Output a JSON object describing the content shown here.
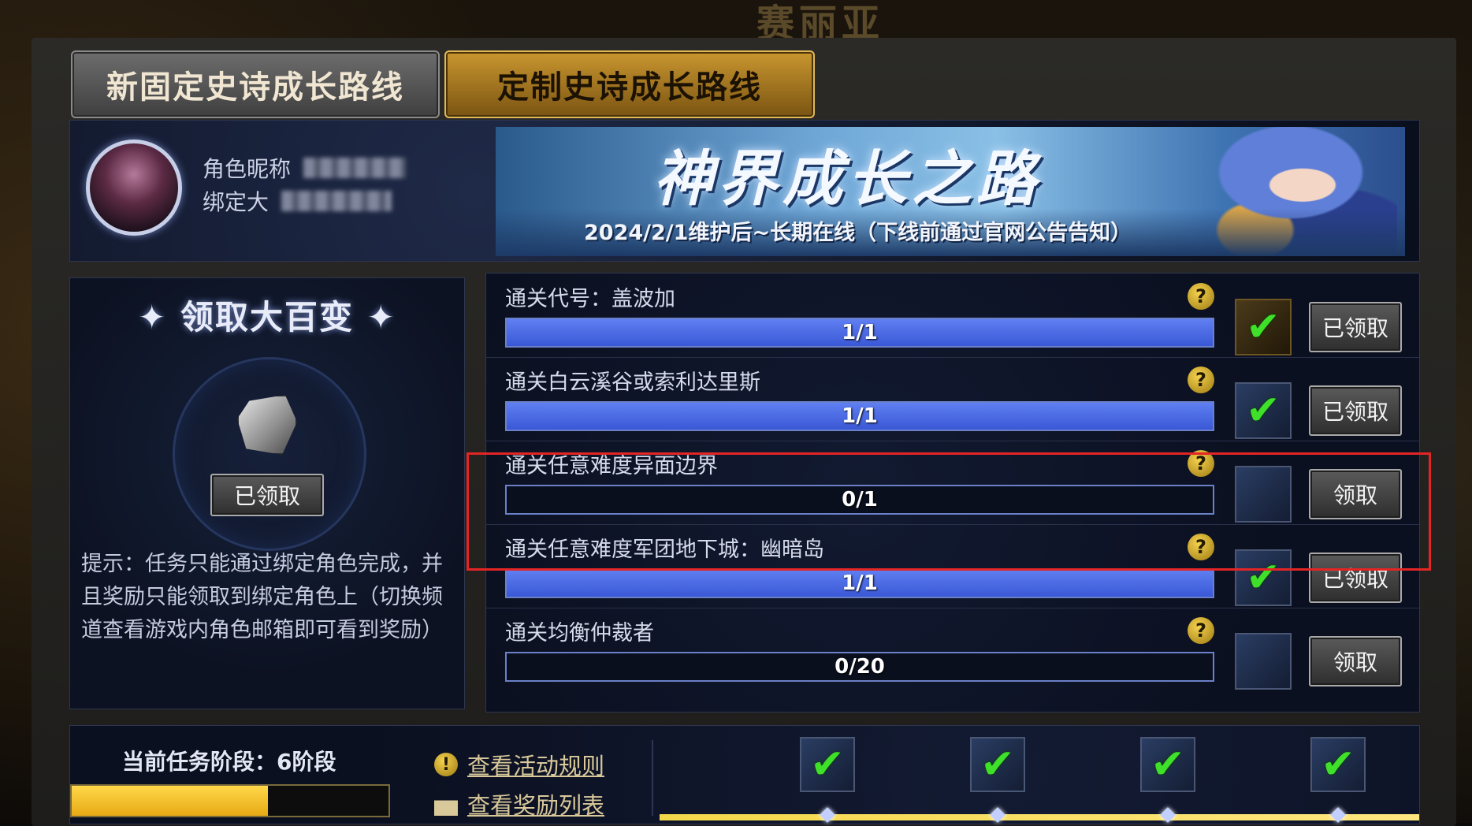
{
  "game": {
    "top_text": "赛丽亚"
  },
  "tabs": [
    {
      "label": "新固定史诗成长路线",
      "active": false
    },
    {
      "label": "定制史诗成长路线",
      "active": true
    }
  ],
  "profile": {
    "nickname_label": "角色昵称",
    "bind_label": "绑定大"
  },
  "banner": {
    "title": "神界成长之路",
    "subtitle": "2024/2/1维护后~长期在线（下线前通过官网公告告知）"
  },
  "left_panel": {
    "title": "✦ 领取大百变 ✦",
    "claim_label": "已领取",
    "tip": "提示：任务只能通过绑定角色完成，并且奖励只能领取到绑定角色上（切换频道查看游戏内角色邮箱即可看到奖励）"
  },
  "quests": [
    {
      "label": "通关代号：盖波加",
      "progress": "1/1",
      "fill": 1,
      "claimed": true,
      "button": "已领取"
    },
    {
      "label": "通关白云溪谷或索利达里斯",
      "progress": "1/1",
      "fill": 1,
      "claimed": true,
      "button": "已领取"
    },
    {
      "label": "通关任意难度异面边界",
      "progress": "0/1",
      "fill": 0,
      "claimed": false,
      "button": "领取"
    },
    {
      "label": "通关任意难度军团地下城：幽暗岛",
      "progress": "1/1",
      "fill": 1,
      "claimed": true,
      "button": "已领取"
    },
    {
      "label": "通关均衡仲裁者",
      "progress": "0/20",
      "fill": 0,
      "claimed": false,
      "button": "领取"
    }
  ],
  "help_glyph": "?",
  "bottom": {
    "stage_label": "当前任务阶段：6阶段",
    "stage_fill": 0.62,
    "rules_link": "查看活动规则",
    "rewards_link": "查看奖励列表",
    "rules_icon": "!"
  },
  "colors": {
    "accent_blue": "#4a68e0",
    "highlight_red": "#e42525",
    "gold": "#c9962f",
    "check_green": "#3fe02a"
  }
}
